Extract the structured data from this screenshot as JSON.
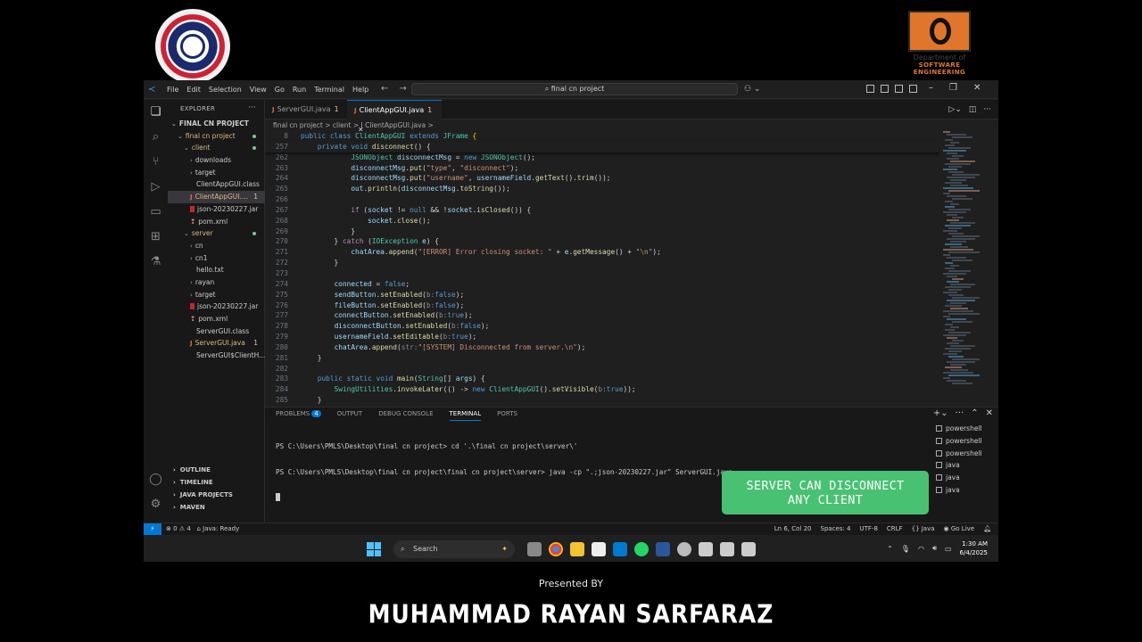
{
  "branding": {
    "presented_by": "Presented BY",
    "author": "MUHAMMAD RAYAN SARFARAZ",
    "dept_logo_line1": "Department of",
    "dept_logo_line2": "SOFTWARE ENGINEERING"
  },
  "titlebar": {
    "menu": [
      "File",
      "Edit",
      "Selection",
      "View",
      "Go",
      "Run",
      "Terminal",
      "Help"
    ],
    "search": "final cn project"
  },
  "explorer": {
    "title": "EXPLORER",
    "root": "FINAL CN PROJECT",
    "items": [
      {
        "label": "final cn project",
        "indent": 1,
        "kind": "folder-open",
        "dot": true,
        "color": "gold"
      },
      {
        "label": "client",
        "indent": 2,
        "kind": "folder-open",
        "dot": true,
        "color": "gold"
      },
      {
        "label": "downloads",
        "indent": 3,
        "kind": "folder"
      },
      {
        "label": "target",
        "indent": 3,
        "kind": "folder"
      },
      {
        "label": "ClientAppGUI.class",
        "indent": 3,
        "kind": "file"
      },
      {
        "label": "ClientAppGUI....",
        "indent": 3,
        "kind": "java",
        "badge": "1",
        "selected": true,
        "color": "gold"
      },
      {
        "label": "json-20230227.jar",
        "indent": 3,
        "kind": "jar"
      },
      {
        "label": "pom.xml",
        "indent": 3,
        "kind": "xml"
      },
      {
        "label": "server",
        "indent": 2,
        "kind": "folder-open",
        "dot": true,
        "color": "gold"
      },
      {
        "label": "cn",
        "indent": 3,
        "kind": "folder"
      },
      {
        "label": "cn1",
        "indent": 3,
        "kind": "folder"
      },
      {
        "label": "hello.txt",
        "indent": 3,
        "kind": "file"
      },
      {
        "label": "rayan",
        "indent": 3,
        "kind": "folder"
      },
      {
        "label": "target",
        "indent": 3,
        "kind": "folder"
      },
      {
        "label": "json-20230227.jar",
        "indent": 3,
        "kind": "jar"
      },
      {
        "label": "pom.xml",
        "indent": 3,
        "kind": "xml"
      },
      {
        "label": "ServerGUI.class",
        "indent": 3,
        "kind": "file"
      },
      {
        "label": "ServerGUI.java",
        "indent": 3,
        "kind": "java",
        "badge": "1",
        "color": "gold"
      },
      {
        "label": "ServerGUI$ClientH...",
        "indent": 3,
        "kind": "file"
      }
    ],
    "sections": [
      "OUTLINE",
      "TIMELINE",
      "JAVA PROJECTS",
      "MAVEN"
    ]
  },
  "tabs": [
    {
      "label": "ServerGUI.java",
      "mod": "1"
    },
    {
      "label": "ClientAppGUI.java",
      "mod": "1",
      "active": true
    }
  ],
  "breadcrumb": "final cn project  >  client  >  J  ClientAppGUI.java  >",
  "sticky": [
    {
      "num": "8",
      "html": "<span class=\"k\">public class</span> <span class=\"t\">ClientAppGUI</span> <span class=\"k\">extends</span> <span class=\"t\">JFrame</span> <span class=\"b\">{</span>"
    },
    {
      "num": "257",
      "html": "    <span class=\"k\">private void</span> <span class=\"f\">disconnect</span><span class=\"n\">() {</span>"
    }
  ],
  "code": [
    {
      "num": "262",
      "html": "            <span class=\"t\">JSONObject</span> <span class=\"v\">disconnectMsg</span> = <span class=\"k\">new</span> <span class=\"t\">JSONObject</span>();"
    },
    {
      "num": "263",
      "html": "            <span class=\"v\">disconnectMsg</span>.<span class=\"f\">put</span>(<span class=\"s\">\"type\"</span>, <span class=\"s\">\"disconnect\"</span>);"
    },
    {
      "num": "264",
      "html": "            <span class=\"v\">disconnectMsg</span>.<span class=\"f\">put</span>(<span class=\"s\">\"username\"</span>, <span class=\"v\">usernameField</span>.<span class=\"f\">getText</span>().<span class=\"f\">trim</span>());"
    },
    {
      "num": "265",
      "html": "            <span class=\"v\">out</span>.<span class=\"f\">println</span>(<span class=\"v\">disconnectMsg</span>.<span class=\"f\">toString</span>());"
    },
    {
      "num": "266",
      "html": ""
    },
    {
      "num": "267",
      "html": "            <span class=\"kw\">if</span> (<span class=\"v\">socket</span> != <span class=\"k\">null</span> &amp;&amp; !<span class=\"v\">socket</span>.<span class=\"f\">isClosed</span>()) {"
    },
    {
      "num": "268",
      "html": "                <span class=\"v\">socket</span>.<span class=\"f\">close</span>();"
    },
    {
      "num": "269",
      "html": "            }"
    },
    {
      "num": "270",
      "html": "        } <span class=\"kw\">catch</span> (<span class=\"t\">IOException</span> <span class=\"v\">e</span>) {"
    },
    {
      "num": "271",
      "html": "            <span class=\"v\">chatArea</span>.<span class=\"f\">append</span>(<span class=\"s\">\"[ERROR] Error closing socket: \"</span> + <span class=\"v\">e</span>.<span class=\"f\">getMessage</span>() + <span class=\"s\">\"\\n\"</span>);"
    },
    {
      "num": "272",
      "html": "        }"
    },
    {
      "num": "273",
      "html": ""
    },
    {
      "num": "274",
      "html": "        <span class=\"v\">connected</span> = <span class=\"k\">false</span>;"
    },
    {
      "num": "275",
      "html": "        <span class=\"v\">sendButton</span>.<span class=\"f\">setEnabled</span>(<span class=\"h\">b:</span><span class=\"k\">false</span>);"
    },
    {
      "num": "276",
      "html": "        <span class=\"v\">fileButton</span>.<span class=\"f\">setEnabled</span>(<span class=\"h\">b:</span><span class=\"k\">false</span>);"
    },
    {
      "num": "277",
      "html": "        <span class=\"v\">connectButton</span>.<span class=\"f\">setEnabled</span>(<span class=\"h\">b:</span><span class=\"k\">true</span>);"
    },
    {
      "num": "278",
      "html": "        <span class=\"v\">disconnectButton</span>.<span class=\"f\">setEnabled</span>(<span class=\"h\">b:</span><span class=\"k\">false</span>);"
    },
    {
      "num": "279",
      "html": "        <span class=\"v\">usernameField</span>.<span class=\"f\">setEditable</span>(<span class=\"h\">b:</span><span class=\"k\">true</span>);"
    },
    {
      "num": "280",
      "html": "        <span class=\"v\">chatArea</span>.<span class=\"f\">append</span>(<span class=\"h\">str:</span><span class=\"s\">\"[SYSTEM] Disconnected from server.\\n\"</span>);"
    },
    {
      "num": "281",
      "html": "    }"
    },
    {
      "num": "282",
      "html": ""
    },
    {
      "num": "283",
      "html": "    <span class=\"k\">public static void</span> <span class=\"f\">main</span>(<span class=\"t\">String</span>[] <span class=\"v\">args</span>) {"
    },
    {
      "num": "284",
      "html": "        <span class=\"t\">SwingUtilities</span>.<span class=\"f\">invokeLater</span>(() -&gt; <span class=\"k\">new</span> <span class=\"t\">ClientAppGUI</span>().<span class=\"f\">setVisible</span>(<span class=\"h\">b:</span><span class=\"k\">true</span>));"
    },
    {
      "num": "285",
      "html": "    }"
    }
  ],
  "panel": {
    "tabs": [
      "PROBLEMS",
      "OUTPUT",
      "DEBUG CONSOLE",
      "TERMINAL",
      "PORTS"
    ],
    "problems_count": "4",
    "terminal_lines": [
      "PS C:\\Users\\PMLS\\Desktop\\final cn project> cd '.\\final cn project\\server\\'",
      "PS C:\\Users\\PMLS\\Desktop\\final cn project\\final cn project\\server> java -cp \".;json-20230227.jar\" ServerGUI.java"
    ],
    "terminal_list": [
      "powershell",
      "powershell",
      "powershell",
      "java",
      "java",
      "java"
    ]
  },
  "overlay": {
    "line1": "SERVER CAN DISCONNECT",
    "line2": "ANY CLIENT"
  },
  "status": {
    "errors": "0",
    "warnings": "4",
    "java": "Java: Ready",
    "position": "Ln 6, Col 20",
    "spaces": "Spaces: 4",
    "encoding": "UTF-8",
    "eol": "CRLF",
    "lang": "{} Java",
    "golive": "Go Live"
  },
  "taskbar": {
    "search": "Search",
    "time": "1:30 AM",
    "date": "6/4/2025"
  },
  "colors": {
    "accent": "#0078d4",
    "overlay": "#48c172",
    "modified": "#e2c08d"
  }
}
